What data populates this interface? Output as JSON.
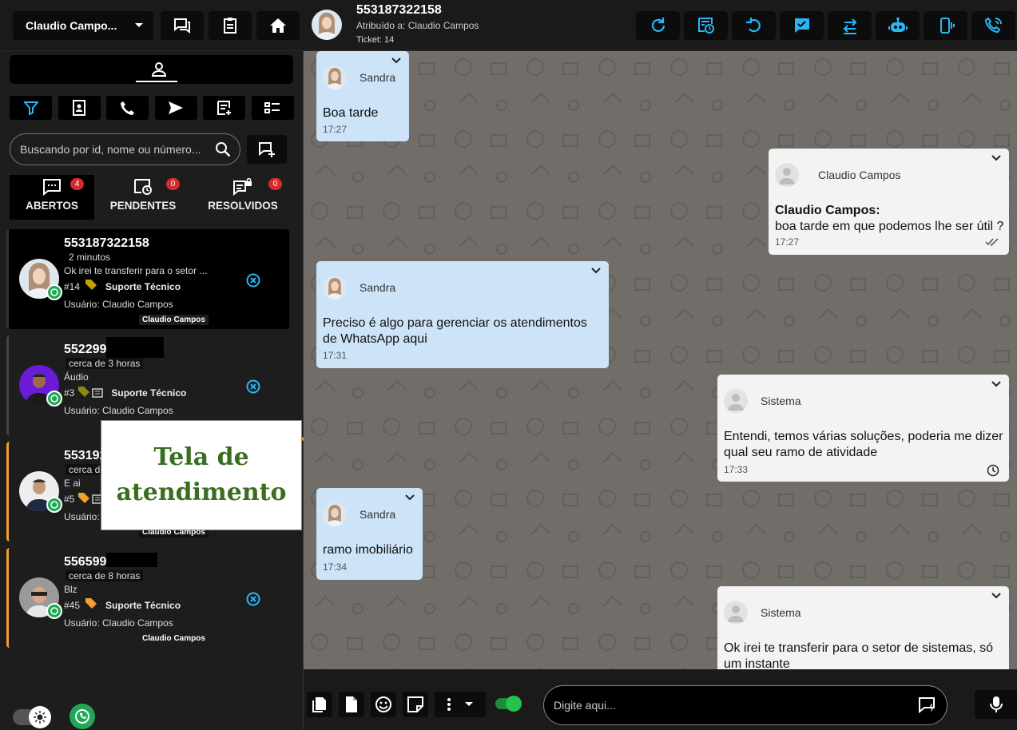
{
  "sidebar": {
    "user_select": "Claudio Campo...",
    "search_placeholder": "Buscando por id, nome ou número...",
    "tabs": [
      {
        "label": "ABERTOS",
        "count": "4"
      },
      {
        "label": "PENDENTES",
        "count": "0"
      },
      {
        "label": "RESOLVIDOS",
        "count": "0"
      }
    ],
    "tickets": [
      {
        "number": "553187322158",
        "time": "2 minutos",
        "message": "Ok irei te transferir para o setor ...",
        "id": "#14",
        "queue": "Suporte Técnico",
        "user": "Usuário: Claudio Campos",
        "tag": "Claudio Campos"
      },
      {
        "number": "552299",
        "time": "cerca de 3 horas",
        "message": "Áudio",
        "id": "#3",
        "queue": "Suporte Técnico",
        "user": "Usuário: Claudio Campos",
        "tag": ""
      },
      {
        "number": "553192",
        "time": "cerca de",
        "message": "E ai",
        "id": "#5",
        "queue": "",
        "user": "Usuário:",
        "tag": "Claudio Campos"
      },
      {
        "number": "556599",
        "time": "cerca de 8 horas",
        "message": "Blz",
        "id": "#45",
        "queue": "Suporte Técnico",
        "user": "Usuário: Claudio Campos",
        "tag": "Claudio Campos"
      }
    ],
    "overlay_label": "Tela de atendimento"
  },
  "chat": {
    "header": {
      "number": "553187322158",
      "assigned": "Atribuído a: Claudio Campos",
      "ticket": "Ticket: 14"
    },
    "messages": [
      {
        "sender": "Sandra",
        "text": "Boa tarde",
        "time": "17:27",
        "direction": "in"
      },
      {
        "sender": "Claudio Campos",
        "author": "Claudio Campos",
        "text": "boa tarde em que podemos lhe ser útil ?",
        "time": "17:27",
        "direction": "out"
      },
      {
        "sender": "Sandra",
        "text": "Preciso é algo para gerenciar os atendimentos de WhatsApp aqui",
        "time": "17:31",
        "direction": "in"
      },
      {
        "sender": "Sistema",
        "text": "Entendi, temos várias soluções, poderia me dizer qual seu ramo de atividade",
        "time": "17:33",
        "direction": "out"
      },
      {
        "sender": "Sandra",
        "text": "ramo imobiliário",
        "time": "17:34",
        "direction": "in"
      },
      {
        "sender": "Sistema",
        "text": "Ok irei te transferir para o setor de sistemas, só um instante",
        "time": "",
        "direction": "out"
      }
    ],
    "composer_placeholder": "Digite aqui..."
  },
  "colors": {
    "accent": "#29b6f6",
    "incoming": "#cde3f7",
    "outgoing": "#f3f3f3",
    "badge": "#d62b2b",
    "ticket_pending_border": "#f0a030",
    "overlay_text": "#3a6e1f",
    "chat_bg": "#716e69"
  }
}
